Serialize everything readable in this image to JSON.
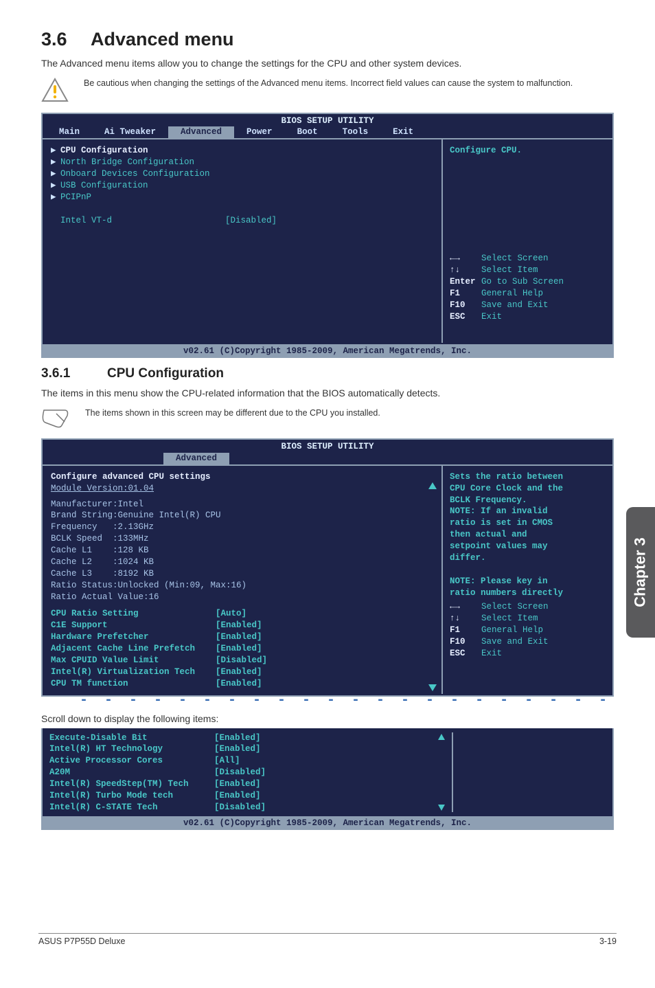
{
  "section": {
    "num": "3.6",
    "title": "Advanced menu"
  },
  "intro": "The Advanced menu items allow you to change the settings for the CPU and other system devices.",
  "warn": "Be cautious when changing the settings of the Advanced menu items. Incorrect field values can cause the system to malfunction.",
  "bios_header": "BIOS SETUP UTILITY",
  "tabs": [
    "Main",
    "Ai Tweaker",
    "Advanced",
    "Power",
    "Boot",
    "Tools",
    "Exit"
  ],
  "bios1": {
    "left": [
      {
        "arrow": true,
        "t": "CPU Configuration",
        "sel": true
      },
      {
        "arrow": true,
        "t": "North Bridge Configuration"
      },
      {
        "arrow": true,
        "t": "Onboard Devices Configuration"
      },
      {
        "arrow": true,
        "t": "USB Configuration"
      },
      {
        "arrow": true,
        "t": "PCIPnP"
      },
      {
        "blank": true
      },
      {
        "t": "Intel VT-d",
        "v": "[Disabled]"
      }
    ],
    "right_top": "Configure CPU.",
    "nav": [
      {
        "k": "←→",
        "v": "Select Screen"
      },
      {
        "k": "↑↓",
        "v": "Select Item"
      },
      {
        "k": "Enter",
        "v": "Go to Sub Screen"
      },
      {
        "k": "F1",
        "v": "General Help"
      },
      {
        "k": "F10",
        "v": "Save and Exit"
      },
      {
        "k": "ESC",
        "v": "Exit"
      }
    ]
  },
  "copyright": "v02.61 (C)Copyright 1985-2009, American Megatrends, Inc.",
  "sub": {
    "num": "3.6.1",
    "title": "CPU Configuration"
  },
  "sub_intro": "The items in this menu show the CPU-related information that the BIOS automatically detects.",
  "note": "The items shown in this screen may be different due to the CPU you installed.",
  "bios2": {
    "left_top": [
      "Configure advanced CPU settings",
      "Module Version:01.04"
    ],
    "info": [
      "Manufacturer:Intel",
      "Brand String:Genuine Intel(R) CPU",
      "Frequency   :2.13GHz",
      "BCLK Speed  :133MHz",
      "Cache L1    :128 KB",
      "Cache L2    :1024 KB",
      "Cache L3    :8192 KB",
      "Ratio Status:Unlocked (Min:09, Max:16)",
      "Ratio Actual Value:16"
    ],
    "opts": [
      {
        "t": "CPU Ratio Setting",
        "v": "[Auto]"
      },
      {
        "t": "C1E Support",
        "v": "[Enabled]"
      },
      {
        "t": "Hardware Prefetcher",
        "v": "[Enabled]"
      },
      {
        "t": "Adjacent Cache Line Prefetch",
        "v": "[Enabled]"
      },
      {
        "t": "Max CPUID Value Limit",
        "v": "[Disabled]"
      },
      {
        "t": "Intel(R) Virtualization Tech",
        "v": "[Enabled]"
      },
      {
        "t": "CPU TM function",
        "v": "[Enabled]"
      }
    ],
    "help": [
      "Sets the ratio between",
      "CPU Core Clock and the",
      "BCLK Frequency.",
      "NOTE: If an invalid",
      "ratio is set in CMOS",
      "then actual and",
      "setpoint values may",
      "differ.",
      "",
      "NOTE: Please key in",
      "ratio numbers directly"
    ],
    "nav": [
      {
        "k": "←→",
        "v": "Select Screen"
      },
      {
        "k": "↑↓",
        "v": "Select Item"
      },
      {
        "k": "F1",
        "v": "General Help"
      },
      {
        "k": "F10",
        "v": "Save and Exit"
      },
      {
        "k": "ESC",
        "v": "Exit"
      }
    ]
  },
  "scroll_intro": "Scroll down to display the following items:",
  "bios3": [
    {
      "t": "Execute-Disable Bit",
      "v": "[Enabled]"
    },
    {
      "t": "Intel(R) HT Technology",
      "v": "[Enabled]"
    },
    {
      "t": "Active Processor Cores",
      "v": "[All]"
    },
    {
      "t": "A20M",
      "v": "[Disabled]"
    },
    {
      "t": "Intel(R) SpeedStep(TM) Tech",
      "v": "[Enabled]"
    },
    {
      "t": "Intel(R) Turbo Mode tech",
      "v": "[Enabled]"
    },
    {
      "t": "Intel(R) C-STATE Tech",
      "v": "[Disabled]"
    }
  ],
  "sidetab": "Chapter 3",
  "footer_left": "ASUS P7P55D Deluxe",
  "footer_right": "3-19"
}
